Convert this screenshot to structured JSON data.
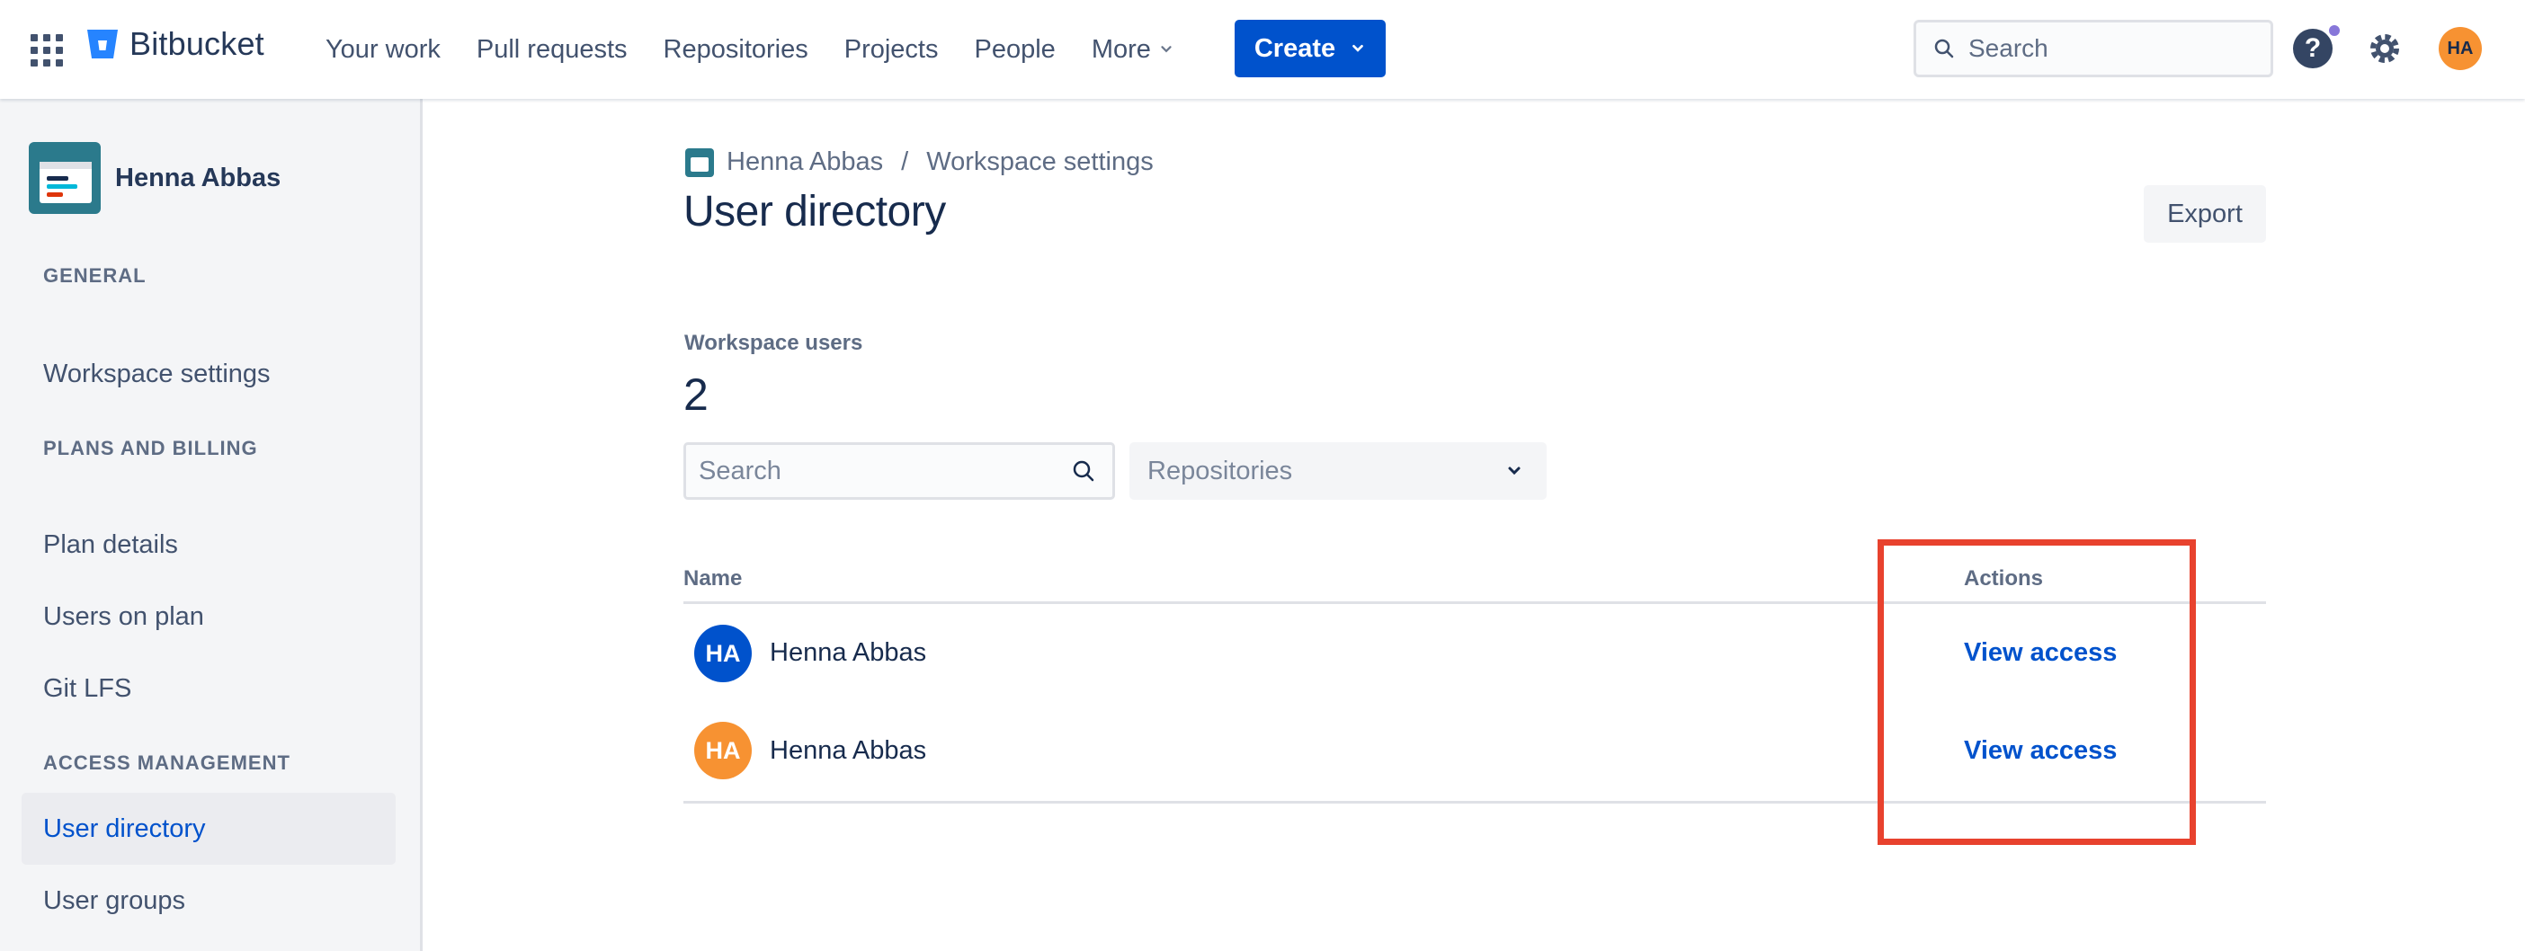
{
  "topbar": {
    "brand": "Bitbucket",
    "nav": [
      "Your work",
      "Pull requests",
      "Repositories",
      "Projects",
      "People"
    ],
    "more_label": "More",
    "create_label": "Create",
    "search_placeholder": "Search",
    "help_glyph": "?",
    "avatar_initials": "HA"
  },
  "sidebar": {
    "workspace_name": "Henna Abbas",
    "sections": {
      "general": "GENERAL",
      "plans": "PLANS AND BILLING",
      "access": "ACCESS MANAGEMENT"
    },
    "items": {
      "workspace_settings": "Workspace settings",
      "plan_details": "Plan details",
      "users_on_plan": "Users on plan",
      "git_lfs": "Git LFS",
      "user_directory": "User directory",
      "user_groups": "User groups"
    }
  },
  "main": {
    "breadcrumb": [
      "Henna Abbas",
      "Workspace settings"
    ],
    "breadcrumb_sep": "/",
    "title": "User directory",
    "export_label": "Export",
    "users_label": "Workspace users",
    "users_count": "2",
    "search_placeholder": "Search",
    "repo_filter": "Repositories",
    "table": {
      "headers": {
        "name": "Name",
        "actions": "Actions"
      },
      "rows": [
        {
          "initials": "HA",
          "name": "Henna Abbas",
          "action": "View access",
          "avatar_color": "#0052cc"
        },
        {
          "initials": "HA",
          "name": "Henna Abbas",
          "action": "View access",
          "avatar_color": "#f79232"
        }
      ]
    }
  },
  "colors": {
    "primary": "#0052cc",
    "highlight": "#e8422e",
    "sidebar_bg": "#f4f5f7"
  }
}
